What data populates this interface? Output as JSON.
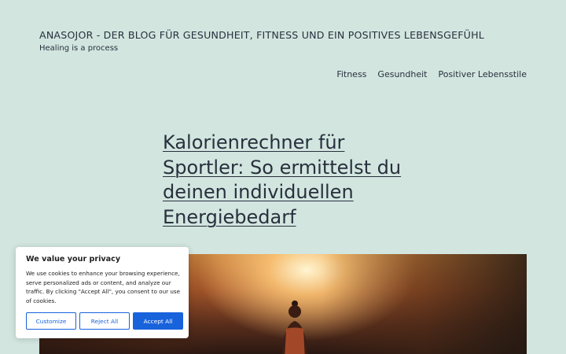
{
  "site": {
    "title": "ANASOJOR - DER BLOG FÜR GESUNDHEIT, FITNESS UND EIN POSITIVES LEBENSGEFÜHL",
    "tagline": "Healing is a process"
  },
  "nav": {
    "items": [
      "Fitness",
      "Gesundheit",
      "Positiver Lebensstile"
    ]
  },
  "post": {
    "title": "Kalorienrechner für Sportler: So ermittelst du deinen individuellen Energiebedarf"
  },
  "cookie_banner": {
    "heading": "We value your privacy",
    "text": "We use cookies to enhance your browsing experience, serve personalized ads or content, and analyze our traffic. By clicking \"Accept All\", you consent to our use of cookies.",
    "customize_label": "Customize",
    "reject_label": "Reject All",
    "accept_label": "Accept All",
    "accent_color": "#1863dc"
  },
  "colors": {
    "background": "#d2e5df",
    "text": "#28303d"
  }
}
